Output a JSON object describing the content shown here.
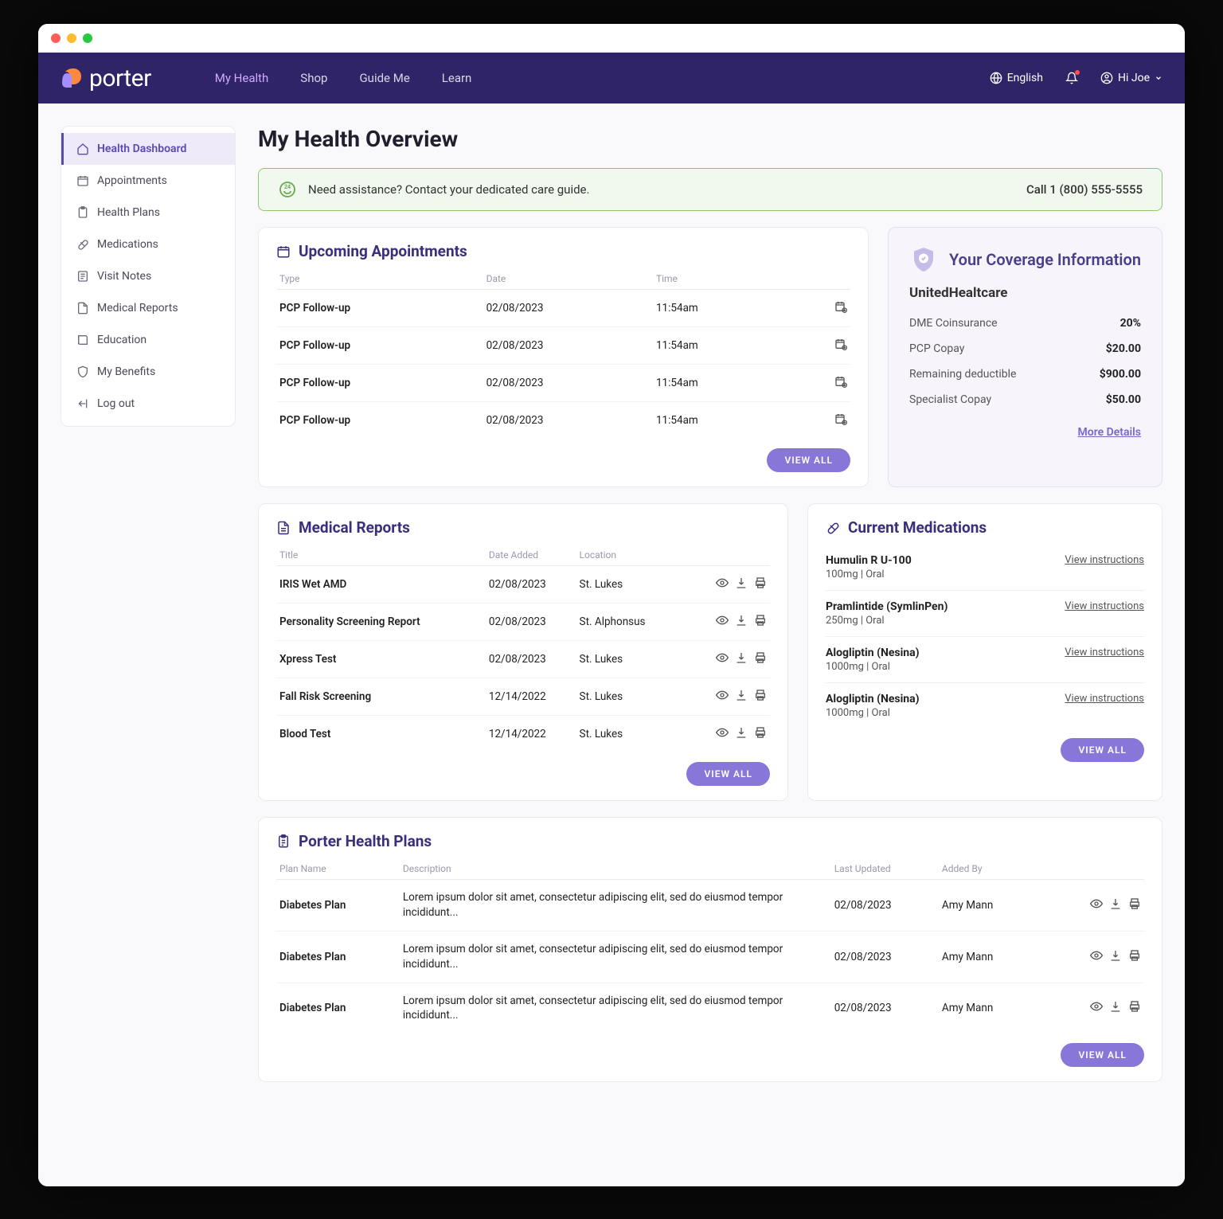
{
  "brand": "porter",
  "nav": {
    "links": [
      "My Health",
      "Shop",
      "Guide Me",
      "Learn"
    ],
    "active_index": 0,
    "language_label": "English",
    "user_greeting": "Hi Joe"
  },
  "sidebar": {
    "items": [
      {
        "label": "Health Dashboard",
        "icon": "home"
      },
      {
        "label": "Appointments",
        "icon": "calendar"
      },
      {
        "label": "Health Plans",
        "icon": "clipboard"
      },
      {
        "label": "Medications",
        "icon": "pill"
      },
      {
        "label": "Visit Notes",
        "icon": "note"
      },
      {
        "label": "Medical Reports",
        "icon": "report"
      },
      {
        "label": "Education",
        "icon": "book"
      },
      {
        "label": "My Benefits",
        "icon": "shield"
      },
      {
        "label": "Log out",
        "icon": "logout"
      }
    ],
    "active_index": 0
  },
  "page_title": "My Health Overview",
  "banner": {
    "text": "Need assistance? Contact your dedicated care guide.",
    "phone": "Call 1 (800) 555-5555"
  },
  "appointments": {
    "title": "Upcoming Appointments",
    "columns": [
      "Type",
      "Date",
      "Time",
      ""
    ],
    "rows": [
      {
        "type": "PCP Follow-up",
        "date": "02/08/2023",
        "time": "11:54am"
      },
      {
        "type": "PCP Follow-up",
        "date": "02/08/2023",
        "time": "11:54am"
      },
      {
        "type": "PCP Follow-up",
        "date": "02/08/2023",
        "time": "11:54am"
      },
      {
        "type": "PCP Follow-up",
        "date": "02/08/2023",
        "time": "11:54am"
      }
    ],
    "view_all": "VIEW ALL"
  },
  "coverage": {
    "title": "Your Coverage Information",
    "provider": "UnitedHealtcare",
    "rows": [
      {
        "label": "DME Coinsurance",
        "value": "20%"
      },
      {
        "label": "PCP Copay",
        "value": "$20.00"
      },
      {
        "label": "Remaining deductible",
        "value": "$900.00"
      },
      {
        "label": "Specialist Copay",
        "value": "$50.00"
      }
    ],
    "more": "More Details"
  },
  "reports": {
    "title": "Medical Reports",
    "columns": [
      "Title",
      "Date Added",
      "Location",
      ""
    ],
    "rows": [
      {
        "title": "IRIS Wet AMD",
        "date": "02/08/2023",
        "location": "St. Lukes"
      },
      {
        "title": "Personality Screening Report",
        "date": "02/08/2023",
        "location": "St. Alphonsus"
      },
      {
        "title": "Xpress Test",
        "date": "02/08/2023",
        "location": "St. Lukes"
      },
      {
        "title": "Fall Risk Screening",
        "date": "12/14/2022",
        "location": "St. Lukes"
      },
      {
        "title": "Blood Test",
        "date": "12/14/2022",
        "location": "St. Lukes"
      }
    ],
    "view_all": "VIEW ALL"
  },
  "medications": {
    "title": "Current Medications",
    "items": [
      {
        "name": "Humulin R U-100",
        "detail": "100mg | Oral",
        "link": "View instructions"
      },
      {
        "name": "Pramlintide (SymlinPen)",
        "detail": "250mg | Oral",
        "link": "View instructions"
      },
      {
        "name": "Alogliptin (Nesina)",
        "detail": "1000mg | Oral",
        "link": "View instructions"
      },
      {
        "name": "Alogliptin (Nesina)",
        "detail": "1000mg | Oral",
        "link": "View instructions"
      }
    ],
    "view_all": "VIEW ALL"
  },
  "plans": {
    "title": "Porter Health Plans",
    "columns": [
      "Plan Name",
      "Description",
      "Last Updated",
      "Added By",
      ""
    ],
    "rows": [
      {
        "name": "Diabetes Plan",
        "desc": "Lorem ipsum dolor sit amet, consectetur adipiscing elit, sed do eiusmod tempor incididunt...",
        "updated": "02/08/2023",
        "added_by": "Amy Mann"
      },
      {
        "name": "Diabetes Plan",
        "desc": "Lorem ipsum dolor sit amet, consectetur adipiscing elit, sed do eiusmod tempor incididunt...",
        "updated": "02/08/2023",
        "added_by": "Amy Mann"
      },
      {
        "name": "Diabetes Plan",
        "desc": "Lorem ipsum dolor sit amet, consectetur adipiscing elit, sed do eiusmod tempor incididunt...",
        "updated": "02/08/2023",
        "added_by": "Amy Mann"
      }
    ],
    "view_all": "VIEW ALL"
  }
}
